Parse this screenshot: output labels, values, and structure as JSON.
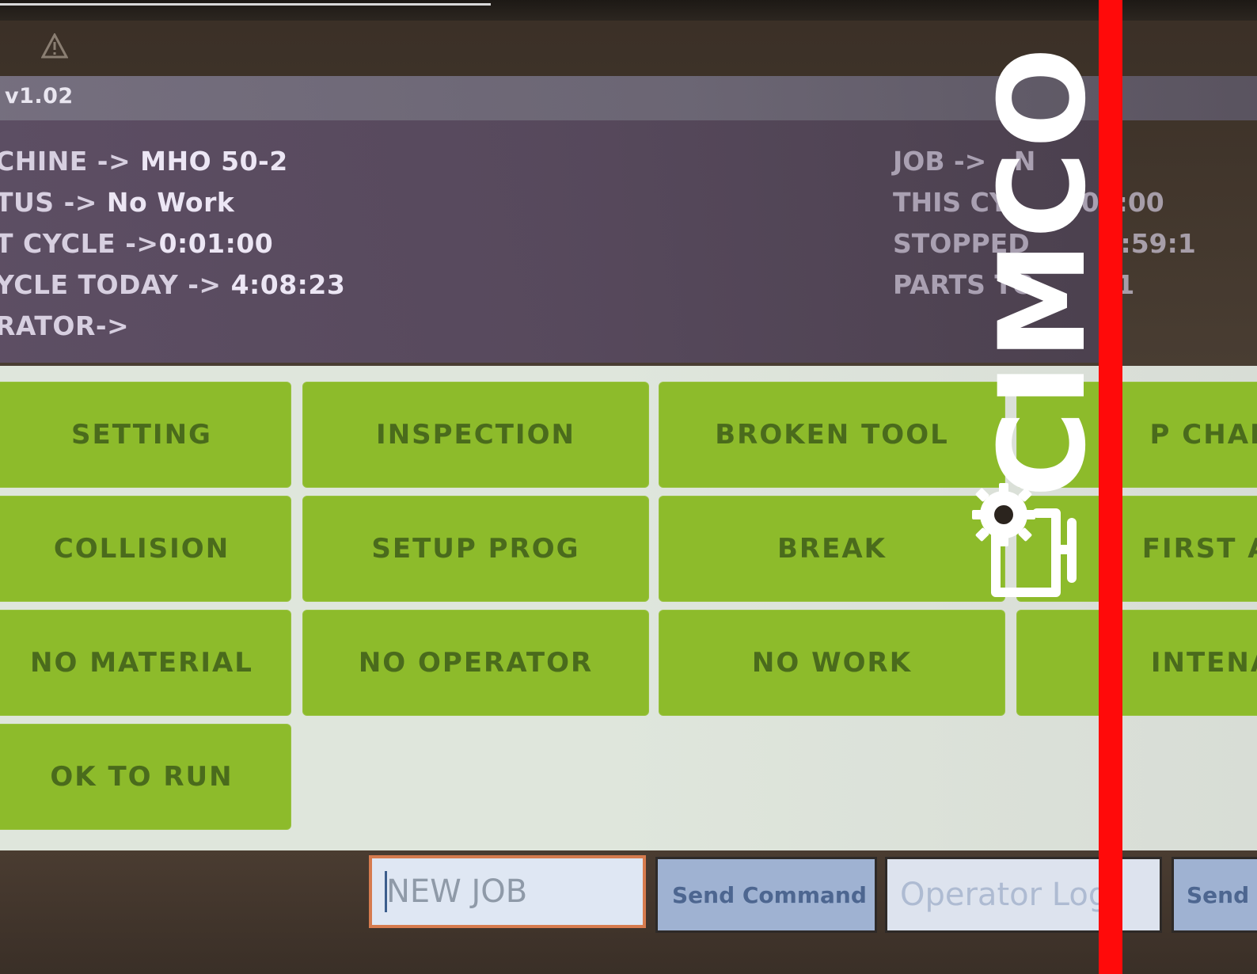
{
  "screen": {
    "version": "v1.02",
    "info_left": [
      {
        "label": "CHINE ->",
        "value": "MHO 50-2"
      },
      {
        "label": "TUS ->",
        "value": "No Work"
      },
      {
        "label": "T CYCLE ->",
        "value": "0:01:00"
      },
      {
        "label": "YCLE TODAY ->",
        "value": "4:08:23"
      },
      {
        "label": "RATOR->",
        "value": ""
      }
    ],
    "info_right": [
      {
        "label": "JOB ->",
        "value": "N"
      },
      {
        "label": "THIS CY",
        "value": "01:00"
      },
      {
        "label": "STOPPED",
        "value": "3:59:1"
      },
      {
        "label": "PARTS TO",
        "value": "01"
      }
    ]
  },
  "buttons": {
    "r1": [
      "SETTING",
      "INSPECTION",
      "BROKEN TOOL",
      "P CHAN"
    ],
    "r2": [
      "COLLISION",
      "SETUP PROG",
      "BREAK",
      "FIRST AI"
    ],
    "r3": [
      "NO MATERIAL",
      "NO OPERATOR",
      "NO WORK",
      "INTENA"
    ],
    "r4": [
      "OK TO RUN"
    ]
  },
  "bottom": {
    "new_job_value": "NEW JOB",
    "send_command": "Send Command",
    "operator_login": "Operator Log",
    "send_short": "Send"
  },
  "logo": {
    "text": "CIMCO",
    "icon": "gear-screen-icon",
    "accent_color": "#ff0a0a"
  },
  "colors": {
    "button_green": "#8dbb2b",
    "button_text": "#4a6b1c"
  }
}
